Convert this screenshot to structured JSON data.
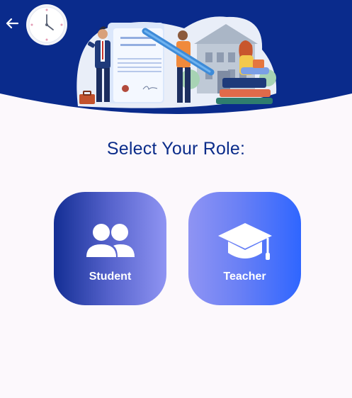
{
  "header": {
    "back_icon": "arrow-left-icon",
    "clock_icon": "clock-icon",
    "illustration": "education-illustration",
    "colors": {
      "banner": "#0a2b8c"
    }
  },
  "main": {
    "title": "Select Your Role:"
  },
  "roles": [
    {
      "label": "Student",
      "icon": "users-icon",
      "gradient": [
        "#132e94",
        "#8f94f3"
      ]
    },
    {
      "label": "Teacher",
      "icon": "graduation-cap-icon",
      "gradient": [
        "#8f94f3",
        "#2f66ff"
      ]
    }
  ],
  "colors": {
    "background": "#fcf8fc",
    "title": "#0b2c8a"
  }
}
